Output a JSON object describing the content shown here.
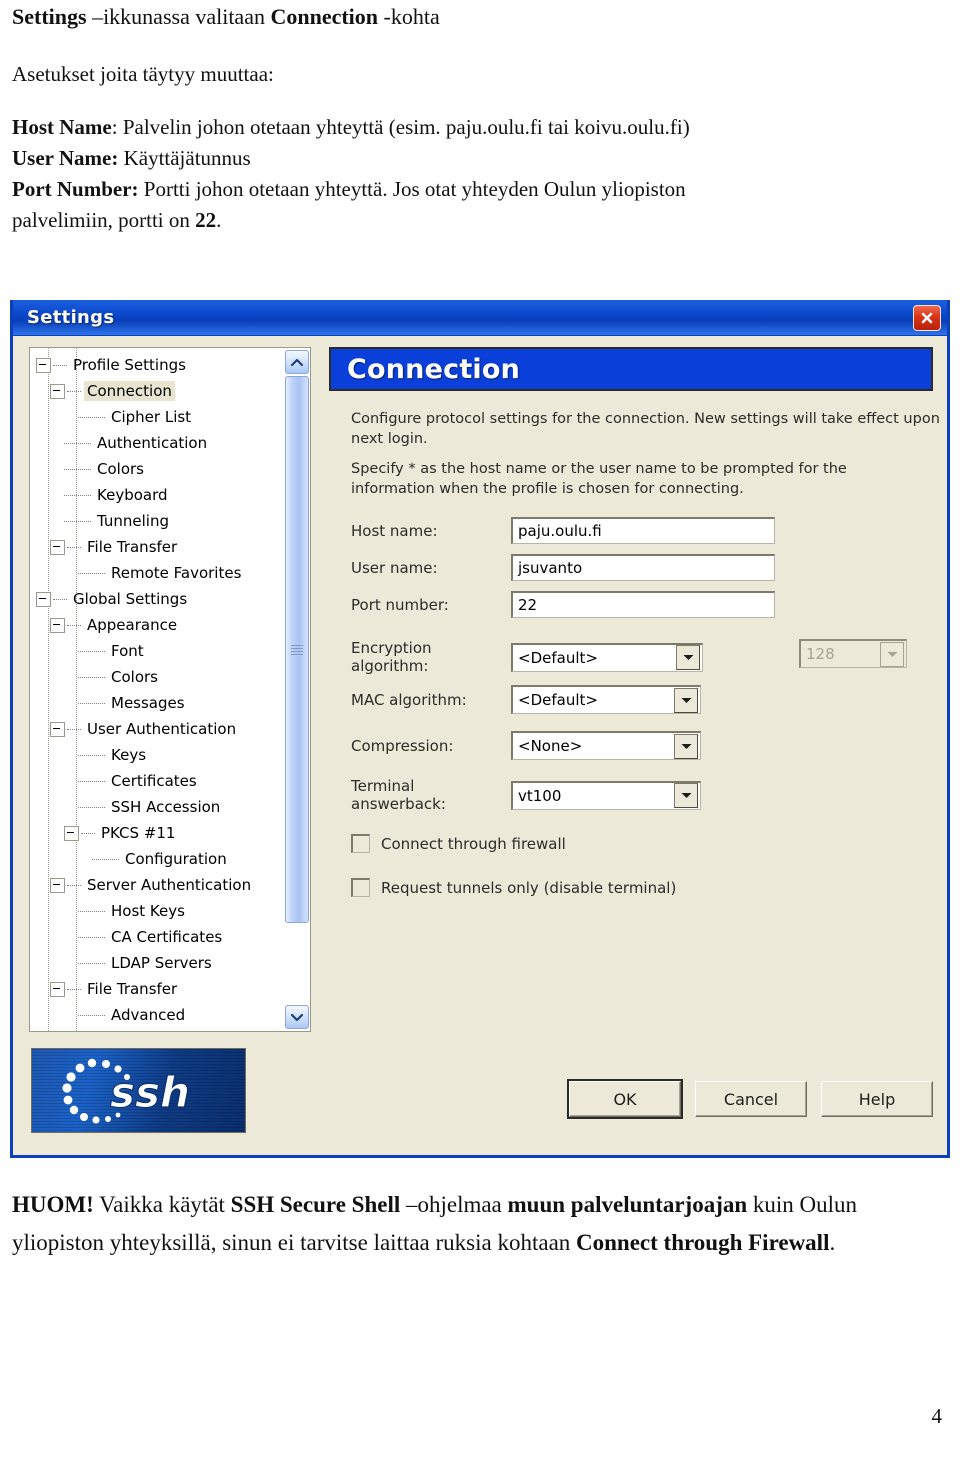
{
  "document": {
    "heading": {
      "part1_bold": "Settings",
      "part2": " –ikkunassa valitaan ",
      "part3_bold": "Connection",
      "part4": " -kohta"
    },
    "intro": "Asetukset joita täytyy muuttaa:",
    "settings_lines": [
      {
        "bold": "Host Name",
        "rest": ": Palvelin johon otetaan yhteyttä (esim. paju.oulu.fi tai koivu.oulu.fi)"
      },
      {
        "bold": "User Name:",
        "rest": " Käyttäjätunnus"
      },
      {
        "bold": "Port Number:",
        "rest": " Portti johon otetaan yhteyttä. Jos otat yhteyden Oulun yliopiston"
      },
      {
        "bold": "",
        "rest": "palvelimiin, portti on ",
        "tail_bold": "22",
        "tail": "."
      }
    ],
    "note": {
      "b1": "HUOM!",
      "t1": " Vaikka käytät ",
      "b2": "SSH Secure Shell",
      "t2": " –ohjelmaa ",
      "b3": "muun paveluntarjoajan",
      "b3_display": "muun palveluntarjoajan",
      "t3": " kuin Oulun yliopiston yhteyksillä, sinun ei tarvitse laittaa ruksia kohtaan ",
      "b4": "Connect through Firewall",
      "t4": "."
    },
    "page_number": "4"
  },
  "dialog": {
    "title": "Settings",
    "close_icon": "close-icon",
    "section_title": "Connection",
    "description_1": "Configure protocol settings for the connection. New settings will take effect upon next login.",
    "description_2": "Specify * as the host name or the user name to be prompted for the information when the profile is chosen for connecting.",
    "tree": {
      "scroll_up_icon": "chevron-up-icon",
      "scroll_down_icon": "chevron-down-icon",
      "items": [
        {
          "label": "Profile Settings",
          "depth": 0,
          "toggle": true,
          "selected": false
        },
        {
          "label": "Connection",
          "depth": 1,
          "toggle": true,
          "selected": true
        },
        {
          "label": "Cipher List",
          "depth": 3,
          "toggle": false,
          "selected": false
        },
        {
          "label": "Authentication",
          "depth": 2,
          "toggle": false,
          "selected": false
        },
        {
          "label": "Colors",
          "depth": 2,
          "toggle": false,
          "selected": false
        },
        {
          "label": "Keyboard",
          "depth": 2,
          "toggle": false,
          "selected": false
        },
        {
          "label": "Tunneling",
          "depth": 2,
          "toggle": false,
          "selected": false
        },
        {
          "label": "File Transfer",
          "depth": 1,
          "toggle": true,
          "selected": false
        },
        {
          "label": "Remote Favorites",
          "depth": 3,
          "toggle": false,
          "selected": false
        },
        {
          "label": "Global Settings",
          "depth": 0,
          "toggle": true,
          "selected": false
        },
        {
          "label": "Appearance",
          "depth": 1,
          "toggle": true,
          "selected": false
        },
        {
          "label": "Font",
          "depth": 3,
          "toggle": false,
          "selected": false
        },
        {
          "label": "Colors",
          "depth": 3,
          "toggle": false,
          "selected": false
        },
        {
          "label": "Messages",
          "depth": 3,
          "toggle": false,
          "selected": false
        },
        {
          "label": "User Authentication",
          "depth": 1,
          "toggle": true,
          "selected": false
        },
        {
          "label": "Keys",
          "depth": 3,
          "toggle": false,
          "selected": false
        },
        {
          "label": "Certificates",
          "depth": 3,
          "toggle": false,
          "selected": false
        },
        {
          "label": "SSH Accession",
          "depth": 3,
          "toggle": false,
          "selected": false
        },
        {
          "label": "PKCS #11",
          "depth": 2,
          "toggle": true,
          "selected": false
        },
        {
          "label": "Configuration",
          "depth": 4,
          "toggle": false,
          "selected": false
        },
        {
          "label": "Server Authentication",
          "depth": 1,
          "toggle": true,
          "selected": false
        },
        {
          "label": "Host Keys",
          "depth": 3,
          "toggle": false,
          "selected": false
        },
        {
          "label": "CA Certificates",
          "depth": 3,
          "toggle": false,
          "selected": false
        },
        {
          "label": "LDAP Servers",
          "depth": 3,
          "toggle": false,
          "selected": false
        },
        {
          "label": "File Transfer",
          "depth": 1,
          "toggle": true,
          "selected": false
        },
        {
          "label": "Advanced",
          "depth": 3,
          "toggle": false,
          "selected": false
        }
      ]
    },
    "form": {
      "host_label": "Host name:",
      "host_value": "paju.oulu.fi",
      "user_label": "User name:",
      "user_value": "jsuvanto",
      "port_label": "Port number:",
      "port_value": "22",
      "encryption_label": "Encryption algorithm:",
      "encryption_value": "<Default>",
      "keylength_value": "128",
      "mac_label": "MAC algorithm:",
      "mac_value": "<Default>",
      "compression_label": "Compression:",
      "compression_value": "<None>",
      "terminal_label": "Terminal answerback:",
      "terminal_value": "vt100",
      "firewall_label": "Connect through firewall",
      "firewall_checked": false,
      "tunnels_label": "Request tunnels only (disable terminal)",
      "tunnels_checked": false,
      "dropdown_icon": "chevron-down-icon"
    },
    "logo": {
      "text": "ssh",
      "name": "ssh-logo"
    },
    "buttons": {
      "ok": "OK",
      "cancel": "Cancel",
      "help": "Help"
    }
  },
  "colors": {
    "titlebar_blue": "#0a46c8",
    "section_blue": "#0b3fd9",
    "dialog_face": "#ece9d8",
    "close_red": "#d93418",
    "scrollbar_blue": "#aac3f4"
  }
}
